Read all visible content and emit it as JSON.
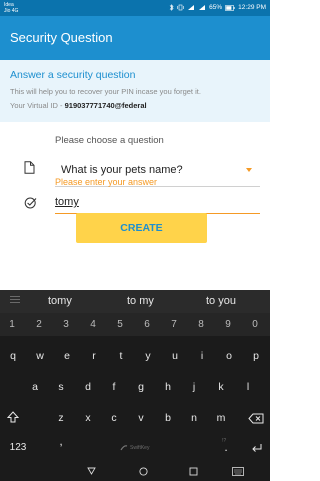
{
  "status_bar": {
    "carrier_line1": "Idea",
    "carrier_line2": "Jio 4G",
    "icons": [
      "bluetooth-icon",
      "vibrate-icon",
      "signal-icon",
      "signal-icon",
      "battery-icon"
    ],
    "battery": "65%",
    "time": "12:29 PM"
  },
  "app_bar": {
    "title": "Security Question"
  },
  "info": {
    "heading": "Answer a security question",
    "description": "This will help you to recover your PIN incase you forget it.",
    "virtual_id_label": "Your Virtual ID - ",
    "virtual_id_value": "919037771740@federal"
  },
  "form": {
    "question_prompt": "Please choose a question",
    "question_value": "What is your pets name?",
    "answer_label": "Please enter your answer",
    "answer_value": "tomy",
    "create_button": "CREATE"
  },
  "colors": {
    "status_bar": "#0b73ad",
    "app_bar": "#1d8fcf",
    "accent_orange": "#f59a25",
    "button_yellow": "#ffd34a",
    "info_bg": "#e8f4fb",
    "keyboard_bg": "#1b1b1b"
  },
  "keyboard": {
    "suggestions": [
      "tomy",
      "to my",
      "to you"
    ],
    "number_row": [
      "1",
      "2",
      "3",
      "4",
      "5",
      "6",
      "7",
      "8",
      "9",
      "0"
    ],
    "row1": [
      "q",
      "w",
      "e",
      "r",
      "t",
      "y",
      "u",
      "i",
      "o",
      "p"
    ],
    "row2": [
      "a",
      "s",
      "d",
      "f",
      "g",
      "h",
      "j",
      "k",
      "l"
    ],
    "row3": [
      "z",
      "x",
      "c",
      "v",
      "b",
      "n",
      "m"
    ],
    "symbols_key": "123",
    "comma_key": ",",
    "period_key": ".",
    "brand": "SwiftKey",
    "hint_symbol": "!?"
  },
  "nav_icons": [
    "back-icon",
    "home-icon",
    "recents-icon",
    "keyboard-icon"
  ]
}
